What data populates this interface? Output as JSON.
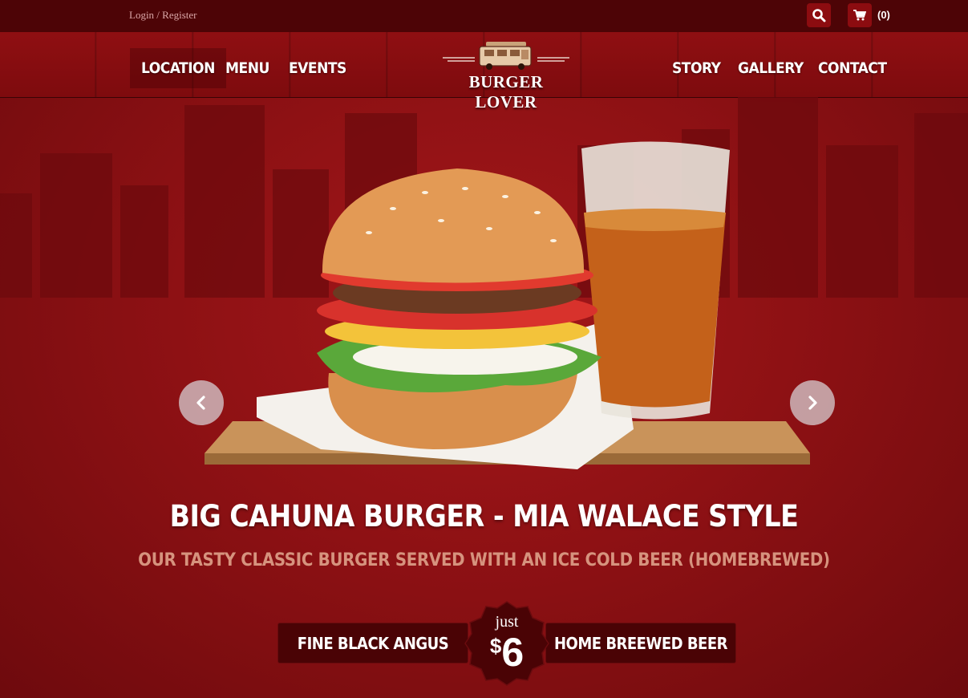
{
  "topbar": {
    "login_label": "Login / Register",
    "search_icon": "search-icon",
    "cart_icon": "cart-icon",
    "cart_count": "(0)"
  },
  "nav": {
    "left": [
      "LOCATION",
      "MENU",
      "EVENTS"
    ],
    "right": [
      "STORY",
      "GALLERY",
      "CONTACT"
    ],
    "active": "LOCATION"
  },
  "logo": {
    "text": "BURGER LOVER",
    "icon": "food-truck-icon"
  },
  "hero": {
    "title": "BIG CAHUNA BURGER - MIA WALACE STYLE",
    "subtitle": "OUR TASTY CLASSIC BURGER SERVED WITH AN ICE COLD BEER (HOMEBREWED)",
    "feature_left": "FINE BLACK ANGUS",
    "feature_right": "HOME BREEWED BEER",
    "price_prefix": "just",
    "currency": "$",
    "price": "6"
  },
  "colors": {
    "background": "#8e1114",
    "topbar": "#4d0406",
    "accent": "#8c0c10",
    "subtitle": "#d6937e"
  }
}
